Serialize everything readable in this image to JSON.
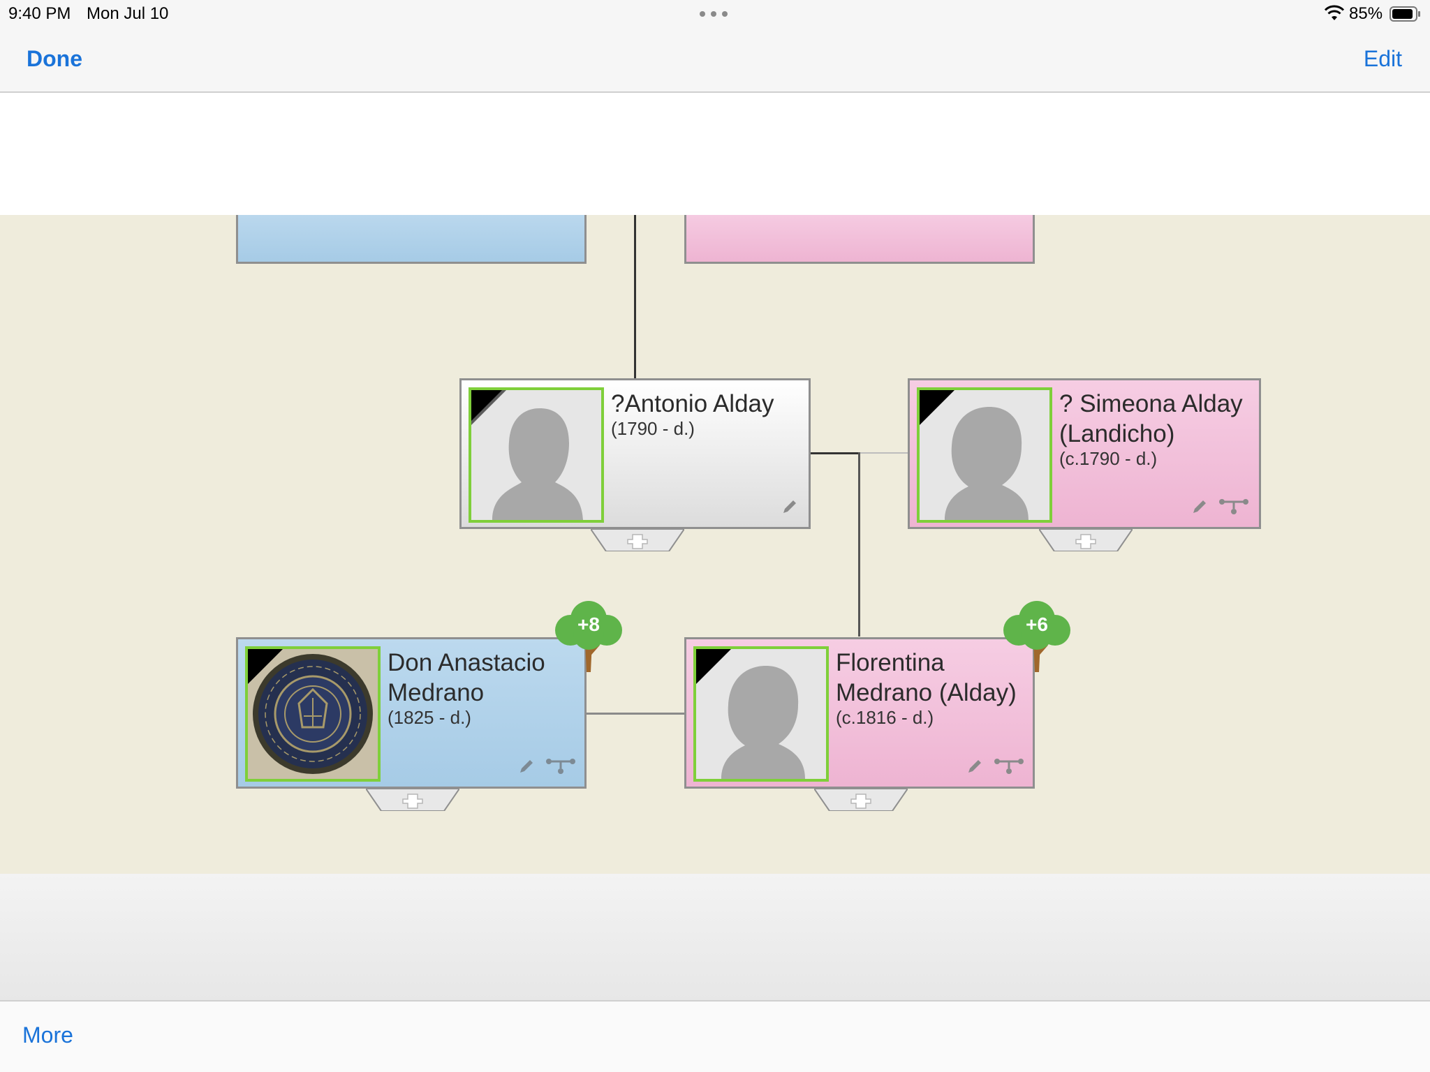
{
  "status_bar": {
    "time": "9:40 PM",
    "date": "Mon Jul 10",
    "battery": "85%"
  },
  "nav": {
    "done_label": "Done",
    "edit_label": "Edit"
  },
  "tree": {
    "people": [
      {
        "name": "?Antonio Alday",
        "dates": "(1790 -  d.)",
        "gender": "unknown",
        "photo": "silhouette-male-icon"
      },
      {
        "name": "? Simeona Alday (Landicho)",
        "dates": "(c.1790 -  d.)",
        "gender": "female",
        "photo": "silhouette-female-icon"
      },
      {
        "name": "Don Anastacio Medrano",
        "dates": "(1825 -  d.)",
        "gender": "male",
        "photo": "seal-photo",
        "descendants": "+8"
      },
      {
        "name": "Florentina Medrano (Alday)",
        "dates": "(c.1816 -  d.)",
        "gender": "female",
        "photo": "silhouette-female-icon",
        "descendants": "+6"
      }
    ],
    "colors": {
      "male": "#a6cbe6",
      "female": "#eeb4d2",
      "canvas": "#efecdc",
      "photo_border": "#7fcf3a",
      "badge": "#5fb44a"
    }
  },
  "toolbar": {
    "more_label": "More"
  }
}
